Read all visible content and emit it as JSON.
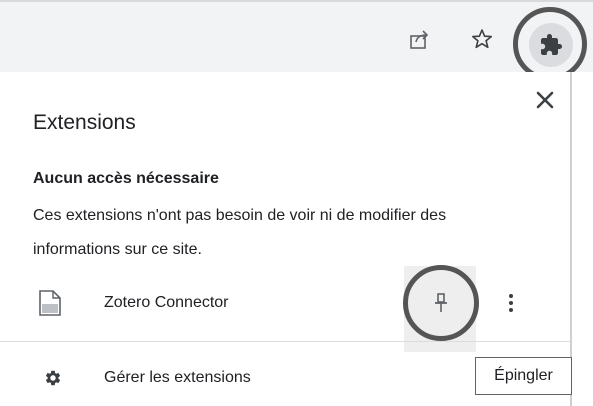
{
  "toolbar": {
    "share_icon": "share-icon",
    "bookmark_icon": "star-icon",
    "extensions_icon": "puzzle-icon"
  },
  "popup": {
    "title": "Extensions",
    "close_icon": "close-icon",
    "section_heading": "Aucun accès nécessaire",
    "section_description": "Ces extensions n'ont pas besoin de voir ni de modifier des informations sur ce site.",
    "extensions": [
      {
        "name": "Zotero Connector",
        "icon": "document-icon",
        "pin_icon": "pin-icon",
        "menu_icon": "more-vertical-icon"
      }
    ],
    "manage_label": "Gérer les extensions",
    "manage_icon": "gear-icon",
    "tooltip": "Épingler"
  },
  "colors": {
    "toolbar_bg": "#f1f3f4",
    "highlight_ring": "#555555",
    "text": "#202124",
    "icon": "#5f6368"
  }
}
